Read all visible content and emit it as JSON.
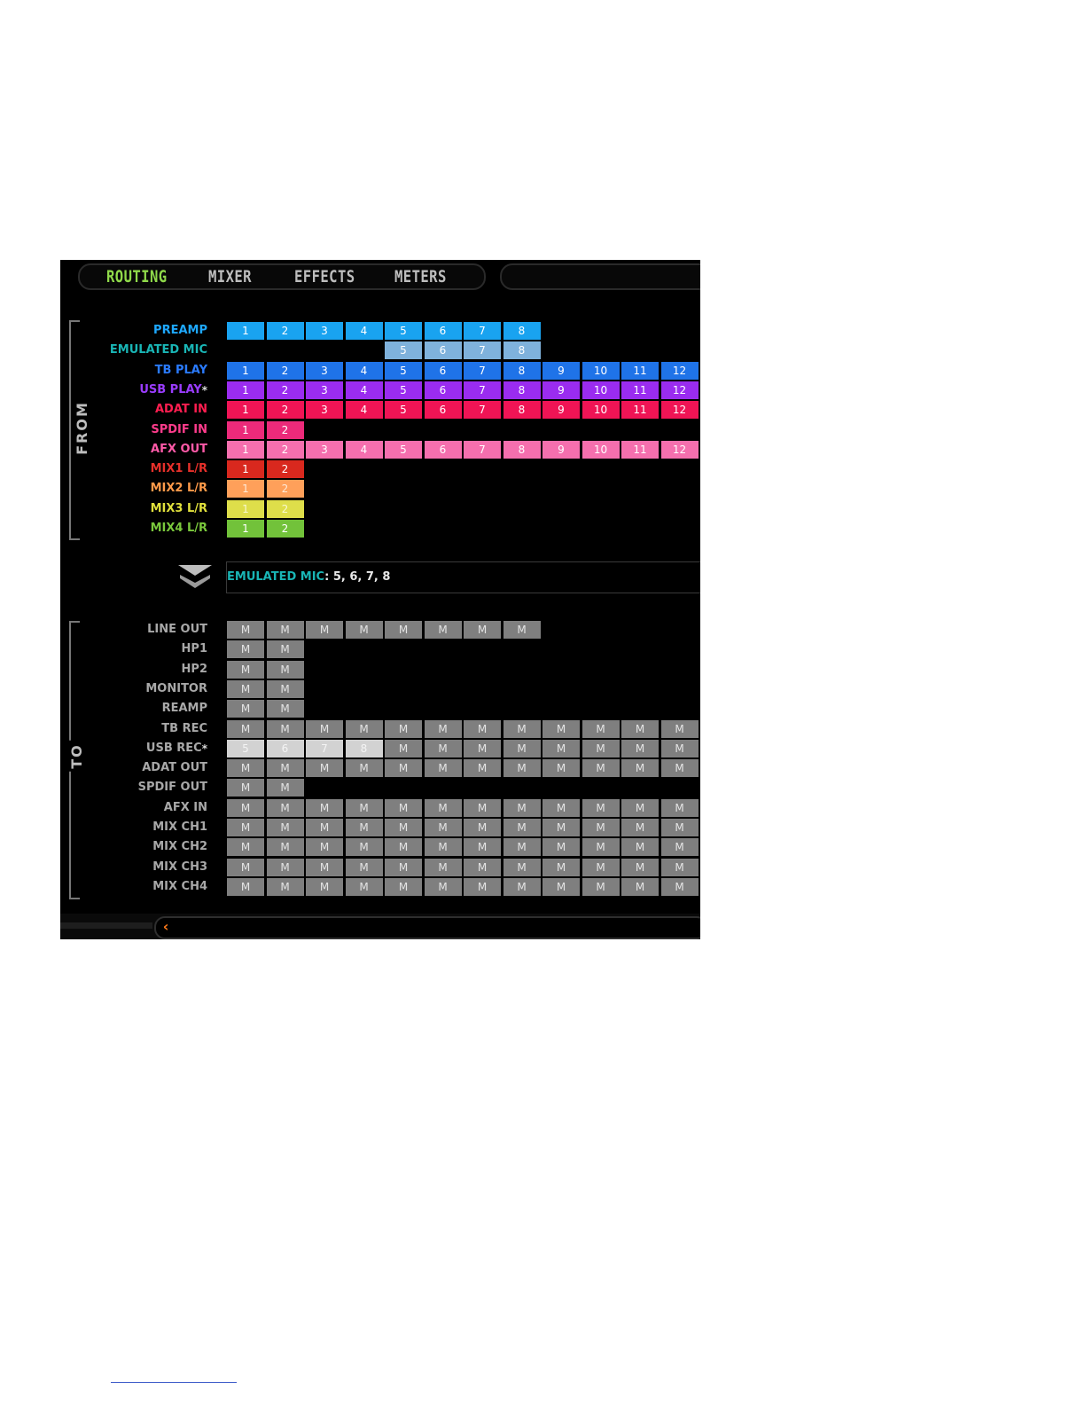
{
  "tabs": [
    {
      "label": "ROUTING",
      "color": "#8fd94a",
      "active": true
    },
    {
      "label": "MIXER",
      "color": "#bdbdbd",
      "active": false
    },
    {
      "label": "EFFECTS",
      "color": "#bdbdbd",
      "active": false
    },
    {
      "label": "METERS",
      "color": "#bdbdbd",
      "active": false
    }
  ],
  "sections": {
    "from_label": "FROM",
    "to_label": "TO"
  },
  "from_rows": [
    {
      "label": "PREAMP",
      "color": "#1ea8ff",
      "cells": [
        "1",
        "2",
        "3",
        "4",
        "5",
        "6",
        "7",
        "8"
      ],
      "start": 0,
      "cell_color": "#19a3f0",
      "text_color": "#ffffff"
    },
    {
      "label": "EMULATED MIC",
      "color": "#19b5b5",
      "cells": [
        "5",
        "6",
        "7",
        "8"
      ],
      "start": 4,
      "cell_color": "#7fb2dc",
      "text_color": "#ffffff"
    },
    {
      "label": "TB PLAY",
      "color": "#2a7bff",
      "cells": [
        "1",
        "2",
        "3",
        "4",
        "5",
        "6",
        "7",
        "8",
        "9",
        "10",
        "11",
        "12"
      ],
      "start": 0,
      "cell_color": "#1f73e8",
      "text_color": "#ffffff"
    },
    {
      "label": "USB PLAY",
      "star": "*",
      "color": "#9a3cff",
      "cells": [
        "1",
        "2",
        "3",
        "4",
        "5",
        "6",
        "7",
        "8",
        "9",
        "10",
        "11",
        "12"
      ],
      "start": 0,
      "cell_color": "#9a2cf0",
      "text_color": "#ffffff"
    },
    {
      "label": "ADAT IN",
      "color": "#ff1e50",
      "cells": [
        "1",
        "2",
        "3",
        "4",
        "5",
        "6",
        "7",
        "8",
        "9",
        "10",
        "11",
        "12"
      ],
      "start": 0,
      "cell_color": "#f01455",
      "text_color": "#ffffff"
    },
    {
      "label": "SPDIF IN",
      "color": "#ff3c8c",
      "cells": [
        "1",
        "2"
      ],
      "start": 0,
      "cell_color": "#ec2a7a",
      "text_color": "#ffffff"
    },
    {
      "label": "AFX OUT",
      "color": "#ff5aa8",
      "cells": [
        "1",
        "2",
        "3",
        "4",
        "5",
        "6",
        "7",
        "8",
        "9",
        "10",
        "11",
        "12"
      ],
      "start": 0,
      "cell_color": "#f56fae",
      "text_color": "#ffffff"
    },
    {
      "label": "MIX1 L/R",
      "color": "#e6302a",
      "cells": [
        "1",
        "2"
      ],
      "start": 0,
      "cell_color": "#d9281e",
      "text_color": "#ffffff"
    },
    {
      "label": "MIX2 L/R",
      "color": "#ff9a4a",
      "cells": [
        "1",
        "2"
      ],
      "start": 0,
      "cell_color": "#ffa05a",
      "text_color": "#ffe9d6"
    },
    {
      "label": "MIX3 L/R",
      "color": "#e0e03c",
      "cells": [
        "1",
        "2"
      ],
      "start": 0,
      "cell_color": "#dede4a",
      "text_color": "#f8f8d0"
    },
    {
      "label": "MIX4 L/R",
      "color": "#7ac83c",
      "cells": [
        "1",
        "2"
      ],
      "start": 0,
      "cell_color": "#72c23a",
      "text_color": "#ffffff"
    }
  ],
  "banner": {
    "label": "EMULATED MIC",
    "label_color": "#19b5b5",
    "value": ": 5, 6, 7, 8"
  },
  "to_rows": [
    {
      "label": "LINE OUT",
      "cells": [
        "M",
        "M",
        "M",
        "M",
        "M",
        "M",
        "M",
        "M"
      ]
    },
    {
      "label": "HP1",
      "cells": [
        "M",
        "M"
      ]
    },
    {
      "label": "HP2",
      "cells": [
        "M",
        "M"
      ]
    },
    {
      "label": "MONITOR",
      "cells": [
        "M",
        "M"
      ]
    },
    {
      "label": "REAMP",
      "cells": [
        "M",
        "M"
      ]
    },
    {
      "label": "TB REC",
      "cells": [
        "M",
        "M",
        "M",
        "M",
        "M",
        "M",
        "M",
        "M",
        "M",
        "M",
        "M",
        "M"
      ]
    },
    {
      "label": "USB REC",
      "star": "*",
      "cells": [
        "5",
        "6",
        "7",
        "8",
        "M",
        "M",
        "M",
        "M",
        "M",
        "M",
        "M",
        "M"
      ],
      "highlight": [
        0,
        1,
        2,
        3
      ]
    },
    {
      "label": "ADAT OUT",
      "cells": [
        "M",
        "M",
        "M",
        "M",
        "M",
        "M",
        "M",
        "M",
        "M",
        "M",
        "M",
        "M"
      ]
    },
    {
      "label": "SPDIF OUT",
      "cells": [
        "M",
        "M"
      ]
    },
    {
      "label": "AFX IN",
      "cells": [
        "M",
        "M",
        "M",
        "M",
        "M",
        "M",
        "M",
        "M",
        "M",
        "M",
        "M",
        "M"
      ]
    },
    {
      "label": "MIX CH1",
      "cells": [
        "M",
        "M",
        "M",
        "M",
        "M",
        "M",
        "M",
        "M",
        "M",
        "M",
        "M",
        "M"
      ]
    },
    {
      "label": "MIX CH2",
      "cells": [
        "M",
        "M",
        "M",
        "M",
        "M",
        "M",
        "M",
        "M",
        "M",
        "M",
        "M",
        "M"
      ]
    },
    {
      "label": "MIX CH3",
      "cells": [
        "M",
        "M",
        "M",
        "M",
        "M",
        "M",
        "M",
        "M",
        "M",
        "M",
        "M",
        "M"
      ]
    },
    {
      "label": "MIX CH4",
      "cells": [
        "M",
        "M",
        "M",
        "M",
        "M",
        "M",
        "M",
        "M",
        "M",
        "M",
        "M",
        "M"
      ]
    }
  ],
  "colors": {
    "to_label": "#a8a8a8",
    "to_cell": "#7f7f7f",
    "to_cell_highlight": "#d2d2d2",
    "back_arrow": "#ff7a1a"
  },
  "icons": {
    "collapse": "double-chevron-down-icon",
    "back": "back-arrow-icon"
  }
}
